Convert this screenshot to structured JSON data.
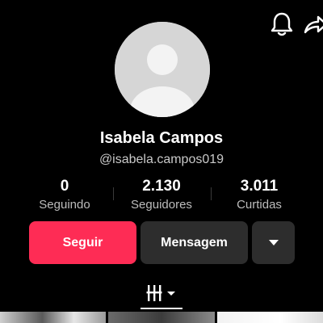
{
  "header": {
    "icons": [
      "bell-icon",
      "share-icon"
    ]
  },
  "profile": {
    "name": "Isabela Campos",
    "handle": "@isabela.campos019",
    "avatar": "default-avatar"
  },
  "stats": [
    {
      "value": "0",
      "label": "Seguindo"
    },
    {
      "value": "2.130",
      "label": "Seguidores"
    },
    {
      "value": "3.011",
      "label": "Curtidas"
    }
  ],
  "actions": {
    "follow_label": "Seguir",
    "message_label": "Mensagem",
    "more_icon": "caret-down-icon"
  },
  "tabs": {
    "active": "grid-icon"
  },
  "colors": {
    "background": "#000000",
    "accent": "#fe2c55",
    "button_dark": "#2d2d2d",
    "muted_text": "#bdbdbd"
  }
}
